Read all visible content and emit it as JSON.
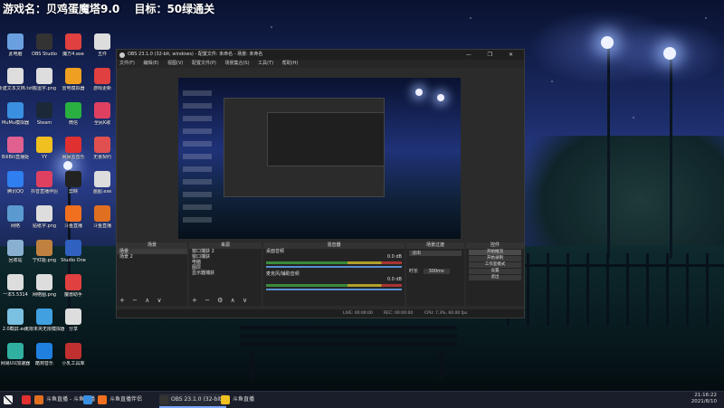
{
  "banner": {
    "part1": "游戏名：贝鸡蛋魔塔9.0",
    "part2": "目标：50绿通关"
  },
  "desktop_icons": [
    {
      "label": "此电脑",
      "color": "#6aa0e0"
    },
    {
      "label": "新建文本文档.txt",
      "color": "#dddddd"
    },
    {
      "label": "MuMu模拟器",
      "color": "#3a8fe0"
    },
    {
      "label": "BiliBili直播姬",
      "color": "#e06090"
    },
    {
      "label": "腾讯QQ",
      "color": "#2f7ff0"
    },
    {
      "label": "网络",
      "color": "#5a9ad0"
    },
    {
      "label": "回收站",
      "color": "#8ab0d0"
    },
    {
      "label": "一本5.5314",
      "color": "#dddddd"
    },
    {
      "label": "2.0截屏.exe",
      "color": "#7ac0e0"
    },
    {
      "label": "网易UU加速器",
      "color": "#30b0a0"
    },
    {
      "label": "OBS Studio",
      "color": "#333333"
    },
    {
      "label": "搬运字.png",
      "color": "#dddddd"
    },
    {
      "label": "Steam",
      "color": "#1b2838"
    },
    {
      "label": "YY",
      "color": "#f0c020"
    },
    {
      "label": "抖音直播伴侣",
      "color": "#e04060"
    },
    {
      "label": "贴纸字.png",
      "color": "#dddddd"
    },
    {
      "label": "宁红姬.png",
      "color": "#c08040"
    },
    {
      "label": "网络图.png",
      "color": "#dddddd"
    },
    {
      "label": "无限未央无限模拟器",
      "color": "#40a0e0"
    },
    {
      "label": "酷狗音乐",
      "color": "#2080e0"
    },
    {
      "label": "魔方4.exe",
      "color": "#e04040"
    },
    {
      "label": "雷电模拟器",
      "color": "#f0a020"
    },
    {
      "label": "微信",
      "color": "#2ab040"
    },
    {
      "label": "网易云音乐",
      "color": "#e03030"
    },
    {
      "label": "剪映",
      "color": "#222222"
    },
    {
      "label": "斗鱼直播",
      "color": "#f07020"
    },
    {
      "label": "Studio One",
      "color": "#3060c0"
    },
    {
      "label": "魔兽助手",
      "color": "#e04040"
    },
    {
      "label": "分享",
      "color": "#dddddd"
    },
    {
      "label": "小乳工具库",
      "color": "#c03030"
    },
    {
      "label": "五件",
      "color": "#dddddd"
    },
    {
      "label": "游戏更新",
      "color": "#e04040"
    },
    {
      "label": "全民K歌",
      "color": "#e04060"
    },
    {
      "label": "无畏契约",
      "color": "#e05050"
    },
    {
      "label": "画图.exe",
      "color": "#dddddd"
    },
    {
      "label": "斗鱼直播",
      "color": "#e07020"
    }
  ],
  "obs": {
    "title": "OBS 23.1.0 (32-bit, windows) - 配置文件: 未命名 - 场景: 未命名",
    "controls": "—  ❐  ✕",
    "menu": [
      "文件(F)",
      "编辑(E)",
      "视图(V)",
      "配置文件(P)",
      "场景集合(S)",
      "工具(T)",
      "帮助(H)"
    ],
    "panels": {
      "scenes": {
        "title": "场景",
        "items": [
          "场景",
          "场景 2"
        ],
        "footer": "+ − ∧ ∨"
      },
      "sources": {
        "title": "来源",
        "items": [
          "窗口捕获 2",
          "窗口捕获",
          "电脑",
          "图层",
          "显示器捕获"
        ],
        "footer": "+ − ⚙ ∧ ∨"
      },
      "mixer": {
        "title": "混音器",
        "channels": [
          {
            "name": "桌面音频",
            "value": "0.0 dB"
          },
          {
            "name": "麦克风/辅助音频",
            "value": "0.0 dB"
          }
        ]
      },
      "transitions": {
        "title": "场景过渡",
        "type": "淡出",
        "duration_label": "时长",
        "duration": "300ms"
      },
      "controls": {
        "title": "控件",
        "buttons": [
          "开始推流",
          "开始录制",
          "工作室模式",
          "设置",
          "退出"
        ]
      }
    },
    "status": {
      "live": "LIVE: 00:00:00",
      "rec": "REC: 00:00:00",
      "cpu": "CPU: 7.3%, 60.00 fps"
    }
  },
  "taskbar": {
    "items": [
      {
        "label": "",
        "color": "#e03030"
      },
      {
        "label": "斗鱼直播 - 斗鱼直播",
        "color": "#e07020"
      },
      {
        "label": "",
        "color": "#3a8fe0"
      },
      {
        "label": "斗鱼直播伴侣",
        "color": "#f07020"
      },
      {
        "label": "OBS 23.1.0 (32-bit...",
        "color": "#333333"
      },
      {
        "label": "斗鱼直播",
        "color": "#f0c020"
      }
    ],
    "time": "21:16:22",
    "date": "2021/8/10"
  }
}
